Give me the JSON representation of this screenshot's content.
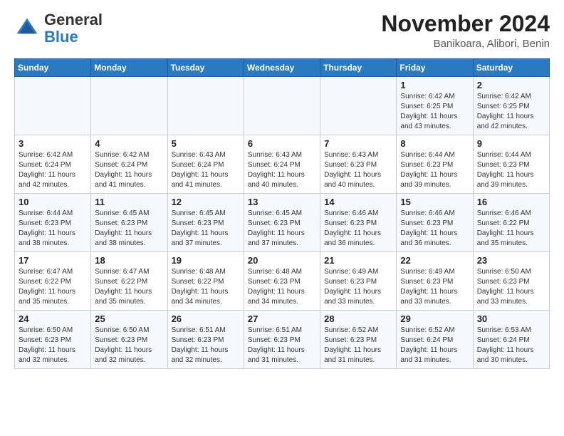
{
  "header": {
    "logo_general": "General",
    "logo_blue": "Blue",
    "month_title": "November 2024",
    "location": "Banikoara, Alibori, Benin"
  },
  "days_of_week": [
    "Sunday",
    "Monday",
    "Tuesday",
    "Wednesday",
    "Thursday",
    "Friday",
    "Saturday"
  ],
  "weeks": [
    [
      {
        "day": "",
        "info": ""
      },
      {
        "day": "",
        "info": ""
      },
      {
        "day": "",
        "info": ""
      },
      {
        "day": "",
        "info": ""
      },
      {
        "day": "",
        "info": ""
      },
      {
        "day": "1",
        "info": "Sunrise: 6:42 AM\nSunset: 6:25 PM\nDaylight: 11 hours and 43 minutes."
      },
      {
        "day": "2",
        "info": "Sunrise: 6:42 AM\nSunset: 6:25 PM\nDaylight: 11 hours and 42 minutes."
      }
    ],
    [
      {
        "day": "3",
        "info": "Sunrise: 6:42 AM\nSunset: 6:24 PM\nDaylight: 11 hours and 42 minutes."
      },
      {
        "day": "4",
        "info": "Sunrise: 6:42 AM\nSunset: 6:24 PM\nDaylight: 11 hours and 41 minutes."
      },
      {
        "day": "5",
        "info": "Sunrise: 6:43 AM\nSunset: 6:24 PM\nDaylight: 11 hours and 41 minutes."
      },
      {
        "day": "6",
        "info": "Sunrise: 6:43 AM\nSunset: 6:24 PM\nDaylight: 11 hours and 40 minutes."
      },
      {
        "day": "7",
        "info": "Sunrise: 6:43 AM\nSunset: 6:23 PM\nDaylight: 11 hours and 40 minutes."
      },
      {
        "day": "8",
        "info": "Sunrise: 6:44 AM\nSunset: 6:23 PM\nDaylight: 11 hours and 39 minutes."
      },
      {
        "day": "9",
        "info": "Sunrise: 6:44 AM\nSunset: 6:23 PM\nDaylight: 11 hours and 39 minutes."
      }
    ],
    [
      {
        "day": "10",
        "info": "Sunrise: 6:44 AM\nSunset: 6:23 PM\nDaylight: 11 hours and 38 minutes."
      },
      {
        "day": "11",
        "info": "Sunrise: 6:45 AM\nSunset: 6:23 PM\nDaylight: 11 hours and 38 minutes."
      },
      {
        "day": "12",
        "info": "Sunrise: 6:45 AM\nSunset: 6:23 PM\nDaylight: 11 hours and 37 minutes."
      },
      {
        "day": "13",
        "info": "Sunrise: 6:45 AM\nSunset: 6:23 PM\nDaylight: 11 hours and 37 minutes."
      },
      {
        "day": "14",
        "info": "Sunrise: 6:46 AM\nSunset: 6:23 PM\nDaylight: 11 hours and 36 minutes."
      },
      {
        "day": "15",
        "info": "Sunrise: 6:46 AM\nSunset: 6:23 PM\nDaylight: 11 hours and 36 minutes."
      },
      {
        "day": "16",
        "info": "Sunrise: 6:46 AM\nSunset: 6:22 PM\nDaylight: 11 hours and 35 minutes."
      }
    ],
    [
      {
        "day": "17",
        "info": "Sunrise: 6:47 AM\nSunset: 6:22 PM\nDaylight: 11 hours and 35 minutes."
      },
      {
        "day": "18",
        "info": "Sunrise: 6:47 AM\nSunset: 6:22 PM\nDaylight: 11 hours and 35 minutes."
      },
      {
        "day": "19",
        "info": "Sunrise: 6:48 AM\nSunset: 6:22 PM\nDaylight: 11 hours and 34 minutes."
      },
      {
        "day": "20",
        "info": "Sunrise: 6:48 AM\nSunset: 6:23 PM\nDaylight: 11 hours and 34 minutes."
      },
      {
        "day": "21",
        "info": "Sunrise: 6:49 AM\nSunset: 6:23 PM\nDaylight: 11 hours and 33 minutes."
      },
      {
        "day": "22",
        "info": "Sunrise: 6:49 AM\nSunset: 6:23 PM\nDaylight: 11 hours and 33 minutes."
      },
      {
        "day": "23",
        "info": "Sunrise: 6:50 AM\nSunset: 6:23 PM\nDaylight: 11 hours and 33 minutes."
      }
    ],
    [
      {
        "day": "24",
        "info": "Sunrise: 6:50 AM\nSunset: 6:23 PM\nDaylight: 11 hours and 32 minutes."
      },
      {
        "day": "25",
        "info": "Sunrise: 6:50 AM\nSunset: 6:23 PM\nDaylight: 11 hours and 32 minutes."
      },
      {
        "day": "26",
        "info": "Sunrise: 6:51 AM\nSunset: 6:23 PM\nDaylight: 11 hours and 32 minutes."
      },
      {
        "day": "27",
        "info": "Sunrise: 6:51 AM\nSunset: 6:23 PM\nDaylight: 11 hours and 31 minutes."
      },
      {
        "day": "28",
        "info": "Sunrise: 6:52 AM\nSunset: 6:23 PM\nDaylight: 11 hours and 31 minutes."
      },
      {
        "day": "29",
        "info": "Sunrise: 6:52 AM\nSunset: 6:24 PM\nDaylight: 11 hours and 31 minutes."
      },
      {
        "day": "30",
        "info": "Sunrise: 6:53 AM\nSunset: 6:24 PM\nDaylight: 11 hours and 30 minutes."
      }
    ]
  ]
}
